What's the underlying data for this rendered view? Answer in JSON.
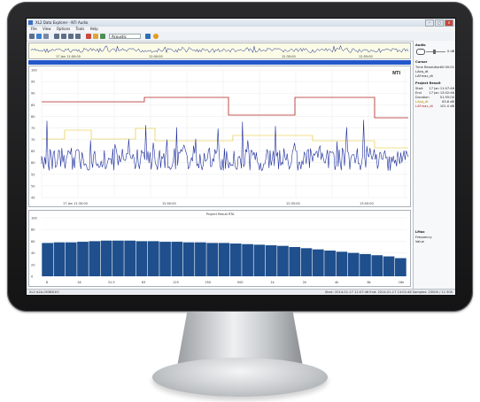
{
  "window": {
    "title": "XL2 Data Explorer - NTi Audio"
  },
  "menu": [
    "File",
    "View",
    "Options",
    "Tools",
    "Help"
  ],
  "toolbar": {
    "dropdown_value": "Acoustic"
  },
  "overview": {
    "time_labels": [
      "17 Jan 11:00:00",
      "12:00:00",
      "12:30:00",
      "12:55:00"
    ]
  },
  "main_chart": {
    "brand": "NTi",
    "y_ticks": [
      "100",
      "95",
      "90",
      "85",
      "80",
      "75",
      "70",
      "65",
      "60",
      "55",
      "50",
      "45"
    ],
    "x_ticks": [
      "17 Jan 11:30:00",
      "12:00:00",
      "12:30:00",
      "13:00:00"
    ]
  },
  "rta_chart": {
    "title": "Project Result RTA",
    "y_ticks": [
      "100",
      "80",
      "60",
      "40",
      "20",
      "0"
    ],
    "x_ticks": [
      "8",
      "16",
      "31.5",
      "63",
      "125",
      "250",
      "500",
      "1k",
      "2k",
      "4k",
      "8k",
      "16k"
    ],
    "bar_levels": [
      57,
      58,
      58,
      59,
      60,
      61,
      61,
      61,
      60,
      60,
      59,
      59,
      58,
      58,
      57,
      57,
      56,
      55,
      54,
      53,
      52,
      50,
      48,
      46,
      44,
      42,
      40,
      38,
      36,
      34,
      31
    ]
  },
  "side_panel": {
    "audio_hdr": "Audio",
    "volume_label": "0 dB",
    "cursor_hdr": "Cursor",
    "time_resolution_label": "Time Resolution",
    "time_resolution_value": "00:00:01",
    "laeq_label": "LAeq_dt",
    "lafmax_label": "LAFmax_dt",
    "project_hdr": "Project Result",
    "start_label": "Start",
    "start_value": "17 Jan 11:07:46",
    "end_label": "End",
    "end_value": "17 Jan 13:02:46",
    "duration_label": "Duration",
    "duration_value": "01:55:00",
    "laeq_value": "63.6 dB",
    "lafmax_value": "101.0 dB",
    "lmax_hdr": "LMax",
    "frequency_label": "Frequency",
    "value_label": "Value"
  },
  "status": {
    "left": "XL2 A2A-05388-E0",
    "right": "Start: 2014-01-17 11:07:46  End: 2014-01-17 13:02:46   Samples: 23000 / 11 500"
  }
}
